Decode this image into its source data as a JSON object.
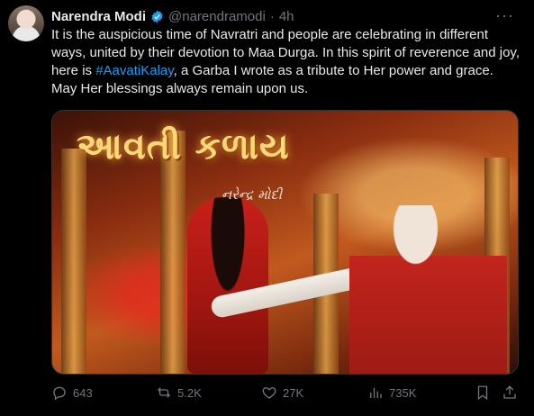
{
  "tweet": {
    "author_name": "Narendra Modi",
    "handle": "@narendramodi",
    "separator": "·",
    "time": "4h",
    "more": "···",
    "text_before": "It is the auspicious time of Navratri and people are celebrating in different ways, united by their devotion to Maa Durga. In this spirit of reverence and joy, here is ",
    "hashtag": "#AavatiKalay",
    "text_after": ", a Garba I wrote as a tribute to Her power and grace. May Her blessings always remain upon us."
  },
  "media": {
    "title_art": "આવતી કળાય",
    "signature": "નરેન્દ્ર મોદી"
  },
  "actions": {
    "replies": "643",
    "reposts": "5.2K",
    "likes": "27K",
    "views": "735K"
  },
  "colors": {
    "background": "#000000",
    "text": "#e7e9ea",
    "muted": "#71767b",
    "link": "#1d9bf0",
    "verified": "#1d9bf0"
  }
}
